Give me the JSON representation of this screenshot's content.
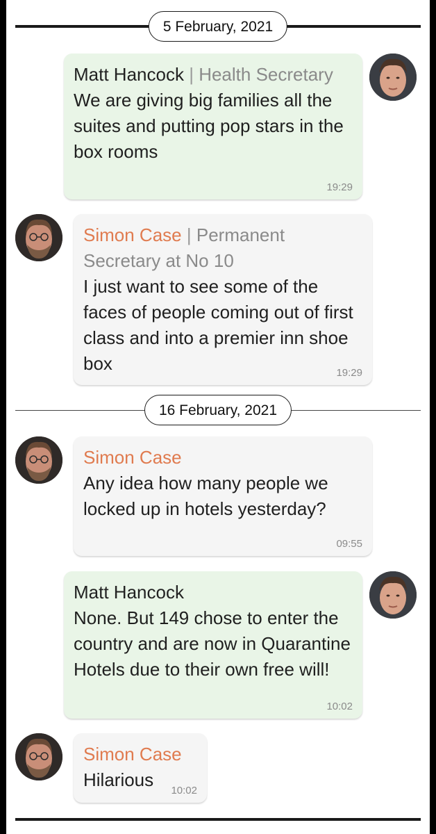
{
  "colors": {
    "outgoing_bubble": "#e9f5e7",
    "incoming_bubble": "#f5f5f5",
    "simon_name": "#e07b4f",
    "role_text": "#8a8a8a"
  },
  "dates": [
    "5 February, 2021",
    "16 February, 2021"
  ],
  "messages": [
    {
      "sender": "Matt Hancock",
      "role_sep": "|",
      "role": "Health Secretary",
      "text": "We are giving big families all the suites and putting pop stars in the box rooms",
      "time": "19:29",
      "avatar": "matt-hancock-avatar"
    },
    {
      "sender": "Simon Case",
      "role_sep": "|",
      "role": "Permanent Secretary at No 10",
      "text": "I just want to see some of the faces of people coming out of first class and into a premier inn shoe box",
      "time": "19:29",
      "avatar": "simon-case-avatar"
    },
    {
      "sender": "Simon Case",
      "text": "Any idea how many people we locked up in hotels yesterday?",
      "time": "09:55",
      "avatar": "simon-case-avatar"
    },
    {
      "sender": "Matt Hancock",
      "text": "None. But 149 chose to enter the country and are now in Quarantine Hotels due to their own free will!",
      "time": "10:02",
      "avatar": "matt-hancock-avatar"
    },
    {
      "sender": "Simon Case",
      "text": "Hilarious",
      "time": "10:02",
      "avatar": "simon-case-avatar"
    }
  ]
}
